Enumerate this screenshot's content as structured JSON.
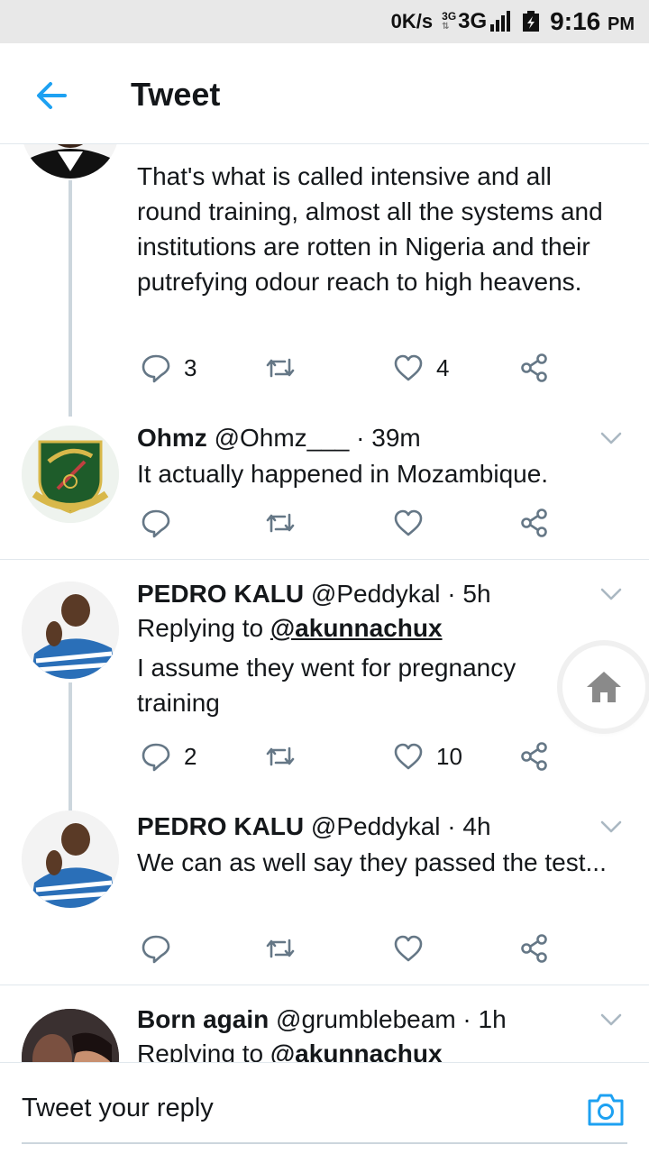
{
  "status_bar": {
    "speed": "0K/s",
    "network_small": "3G",
    "network": "3G",
    "time": "9:16",
    "ampm": "PM"
  },
  "header": {
    "title": "Tweet"
  },
  "tweets": [
    {
      "body": "That's what is called intensive and all round training, almost all the systems and institutions are rotten in Nigeria and their putrefying odour reach to high heavens.",
      "replies": "3",
      "retweets": "",
      "likes": "4"
    },
    {
      "name": "Ohmz",
      "handle": "@Ohmz___",
      "time": "· 39m",
      "body": "It actually happened in Mozambique.",
      "replies": "",
      "retweets": "",
      "likes": ""
    },
    {
      "name": "PEDRO KALU",
      "handle": "@Peddykal",
      "time": "· 5h",
      "reply_prefix": "Replying to",
      "reply_mention": "@akunnachux",
      "body": "I assume they went for pregnancy training",
      "replies": "2",
      "retweets": "",
      "likes": "10"
    },
    {
      "name": "PEDRO KALU",
      "handle": "@Peddykal",
      "time": "· 4h",
      "body": "We can as well say they passed the test...",
      "replies": "",
      "retweets": "",
      "likes": ""
    },
    {
      "name": "Born again",
      "handle": "@grumblebeam",
      "time": "· 1h",
      "reply_prefix": "Replying to",
      "reply_mention": "@akunnachux"
    }
  ],
  "reply_bar": {
    "placeholder": "Tweet your reply"
  },
  "colors": {
    "accent": "#1da1f2",
    "icon_gray": "#657786",
    "thread_line": "#ccd6dd"
  }
}
